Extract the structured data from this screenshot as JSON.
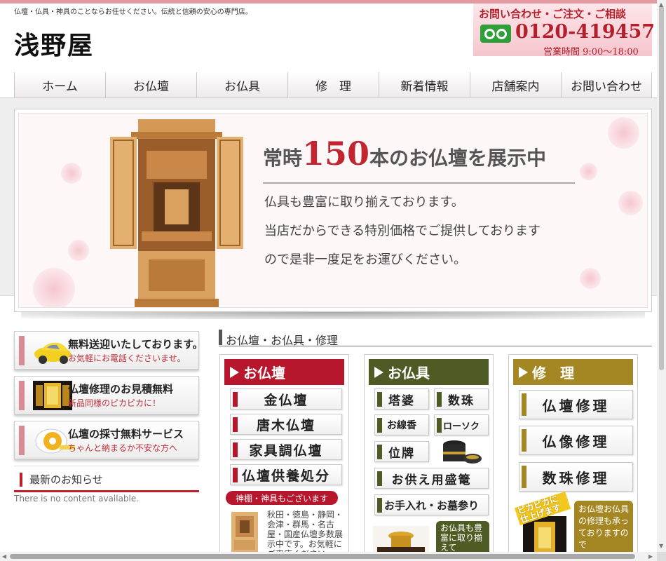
{
  "header": {
    "tagline": "仏壇・仏具・神具のことならお任せください。伝統と信頼の安心の専門店。",
    "logo": "浅野屋",
    "contact_title": "お問い合わせ・ご注文・ご相談",
    "phone": "0120-419457",
    "hours": "営業時間 9:00～18:00"
  },
  "nav": [
    "ホーム",
    "お仏壇",
    "お仏具",
    "修　理",
    "新着情報",
    "店舗案内",
    "お問い合わせ"
  ],
  "hero": {
    "headline_pre": "常時",
    "headline_num": "150",
    "headline_post": "本のお仏壇を展示中",
    "lines": [
      "仏具も豊富に取り揃えております。",
      "当店だからできる特別価格でご提供しております",
      "ので是非一度足をお運びください。"
    ]
  },
  "sidebar": {
    "banners": [
      {
        "title": "無料送迎いたしております。",
        "sub": "お気軽にお電話くださいませ。"
      },
      {
        "title": "仏壇修理のお見積無料",
        "sub": "新品同様のピカピカに！"
      },
      {
        "title": "仏壇の採寸無料サービス",
        "sub": "ちゃんと納まるか不安な方へ"
      }
    ],
    "news_heading": "最新のお知らせ",
    "news_empty": "There is no content available."
  },
  "section_title": "お仏壇・お仏具・修理",
  "columns": {
    "butsudan": {
      "title": "お仏壇",
      "buttons": [
        "金仏壇",
        "唐木仏壇",
        "家具調仏壇",
        "仏壇供養処分"
      ],
      "pill": "神棚・神具もございます",
      "text": "秋田・徳島・静岡・会津・群馬・名古屋・国産仏壇多数展示中です。お気軽にご来店ください。"
    },
    "butsugu": {
      "title": "お仏具",
      "small_buttons": [
        "塔婆",
        "数珠",
        "お線香",
        "ローソク",
        "位牌"
      ],
      "wide_buttons": [
        "お供え用盛篭",
        "お手入れ・お墓参り"
      ],
      "note": "お仏具も豊富に取り揃えて"
    },
    "shuri": {
      "title": "修　理",
      "buttons": [
        "仏壇修理",
        "仏像修理",
        "数珠修理"
      ],
      "badge": "ピカピカに仕上げます",
      "note": "お仏壇お仏具の修理も承っておりますので"
    }
  },
  "colors": {
    "accent_red": "#c0202c",
    "butsudan_head": "#b7162c",
    "butsugu_head": "#4e5b25",
    "shuri_head": "#a48622"
  }
}
